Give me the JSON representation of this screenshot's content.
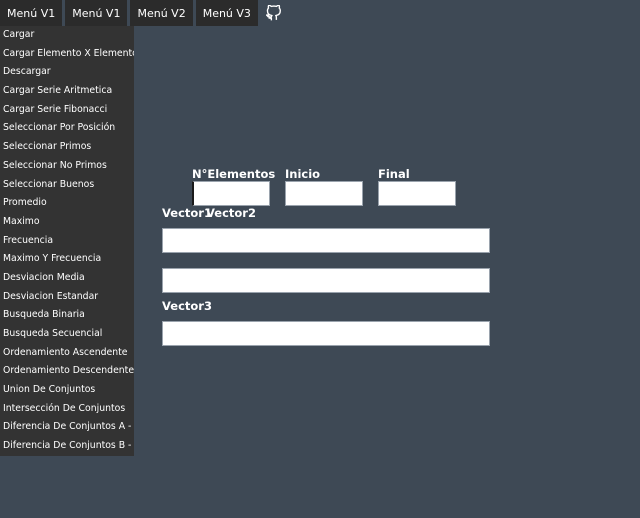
{
  "topbar": {
    "tabs": [
      "Menú V1",
      "Menú V1",
      "Menú V2",
      "Menú V3"
    ],
    "github_icon": "github-icon"
  },
  "sidebar": {
    "items": [
      "Cargar",
      "Cargar Elemento X Elemento",
      "Descargar",
      "Cargar Serie Aritmetica",
      "Cargar Serie Fibonacci",
      "Seleccionar Por Posición",
      "Seleccionar Primos",
      "Seleccionar No Primos",
      "Seleccionar Buenos",
      "Promedio",
      "Maximo",
      "Frecuencia",
      "Maximo Y Frecuencia",
      "Desviacion Media",
      "Desviacion Estandar",
      "Busqueda Binaria",
      "Busqueda Secuencial",
      "Ordenamiento Ascendente",
      "Ordenamiento Descendente",
      "Union De Conjuntos",
      "Intersección De Conjuntos",
      "Diferencia De Conjuntos A - B",
      "Diferencia De Conjuntos B - A"
    ]
  },
  "form": {
    "n_elementos_label": "N°Elementos",
    "inicio_label": "Inicio",
    "final_label": "Final",
    "vector1_label": "Vector1",
    "vector2_label": "Vector2",
    "vector3_label": "Vector3",
    "n_elementos_value": "",
    "inicio_value": "",
    "final_value": "",
    "vector1_value": "",
    "vector2_value": "",
    "vector3_value": ""
  },
  "colors": {
    "background": "#3e4955",
    "menu_background": "#333333",
    "tab_background": "#2b2b2b",
    "text": "#ffffff"
  }
}
